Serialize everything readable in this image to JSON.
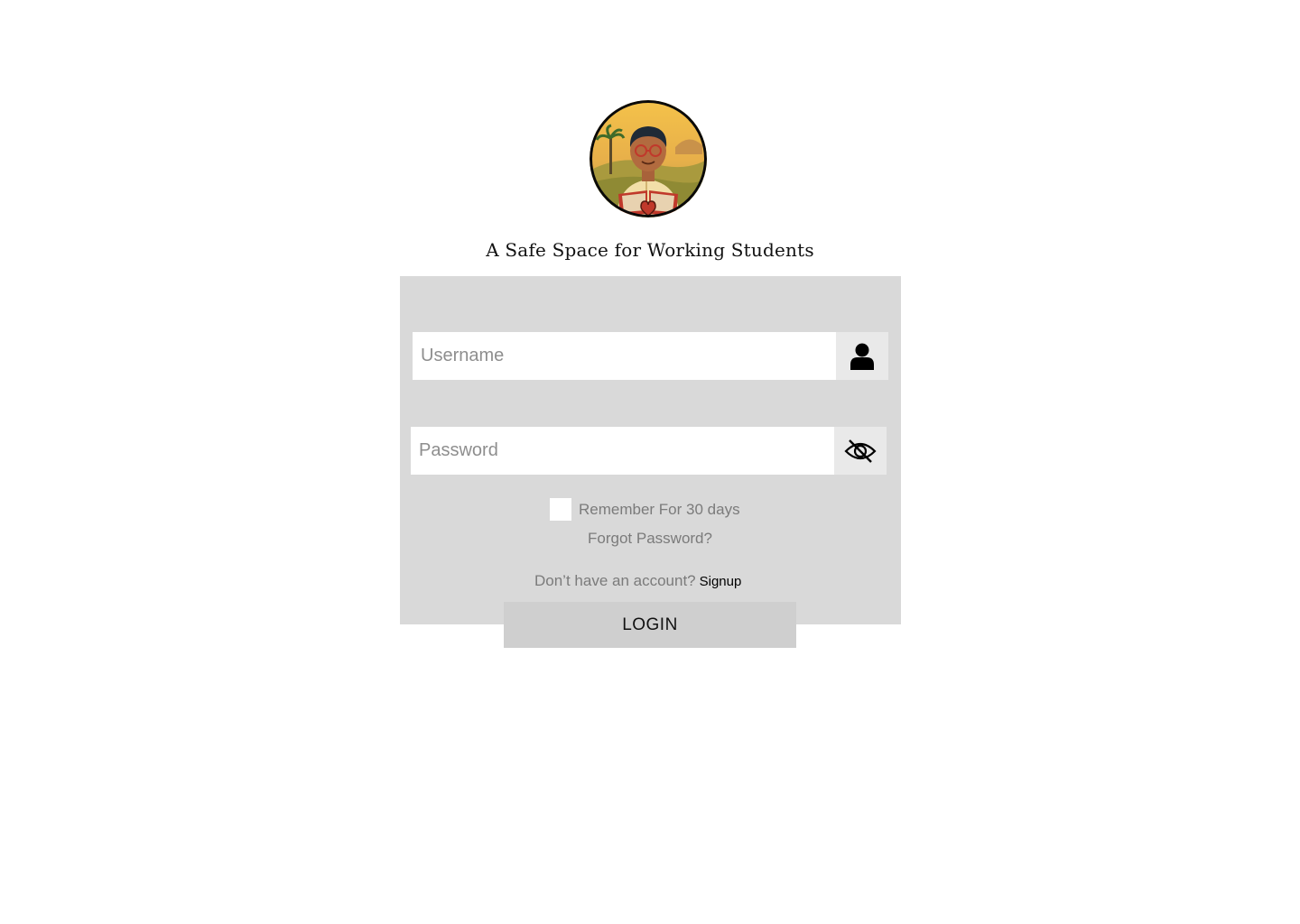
{
  "brand": {
    "logo_icon": "student-reading-book-logo",
    "tagline": "A Safe Space for Working Students"
  },
  "form": {
    "username": {
      "placeholder": "Username",
      "value": "",
      "icon": "user-icon"
    },
    "password": {
      "placeholder": "Password",
      "value": "",
      "icon": "eye-slash-icon"
    },
    "remember_label": "Remember For 30 days",
    "remember_checked": false,
    "forgot_label": "Forgot Password?",
    "signup_prompt": "Don’t have an account?",
    "signup_link": "Signup",
    "login_label": "LOGIN"
  },
  "colors": {
    "panel_bg": "#d9d9d9",
    "input_bg": "#ffffff",
    "addon_bg": "#e9e9e9",
    "button_bg": "#cfcfcf",
    "muted_text": "#7b7b7b"
  }
}
